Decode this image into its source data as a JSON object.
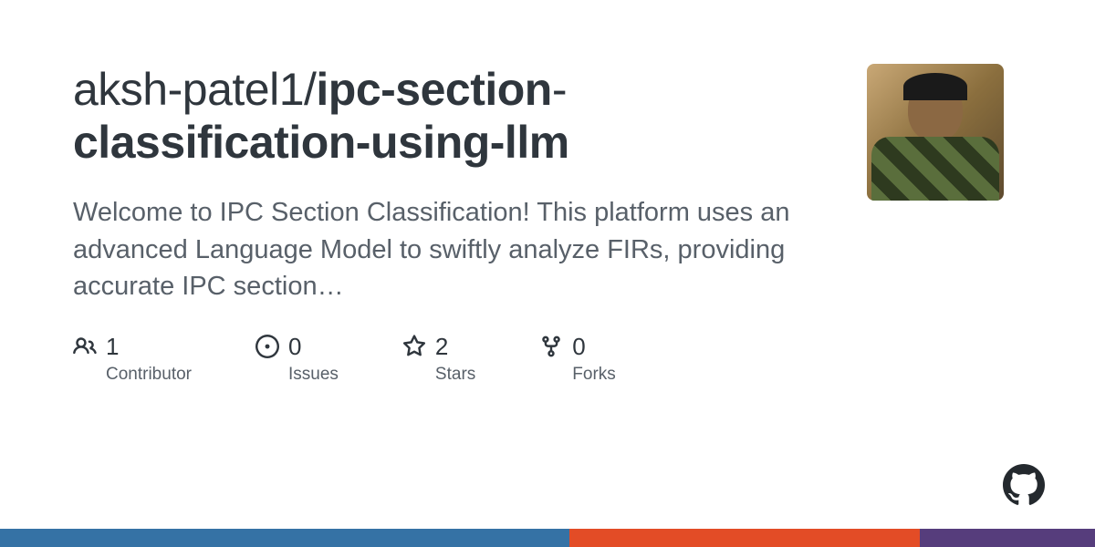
{
  "repo": {
    "owner": "aksh-patel1",
    "name_part1": "ipc-section",
    "name_part2": "classification-using-llm"
  },
  "description": "Welcome to IPC Section Classification! This platform uses an advanced Language Model to swiftly analyze FIRs, providing accurate IPC section…",
  "stats": {
    "contributors": {
      "count": "1",
      "label": "Contributor"
    },
    "issues": {
      "count": "0",
      "label": "Issues"
    },
    "stars": {
      "count": "2",
      "label": "Stars"
    },
    "forks": {
      "count": "0",
      "label": "Forks"
    }
  },
  "colors": {
    "lang1": "#3572A5",
    "lang2": "#e34c26",
    "lang3": "#563d7c"
  }
}
